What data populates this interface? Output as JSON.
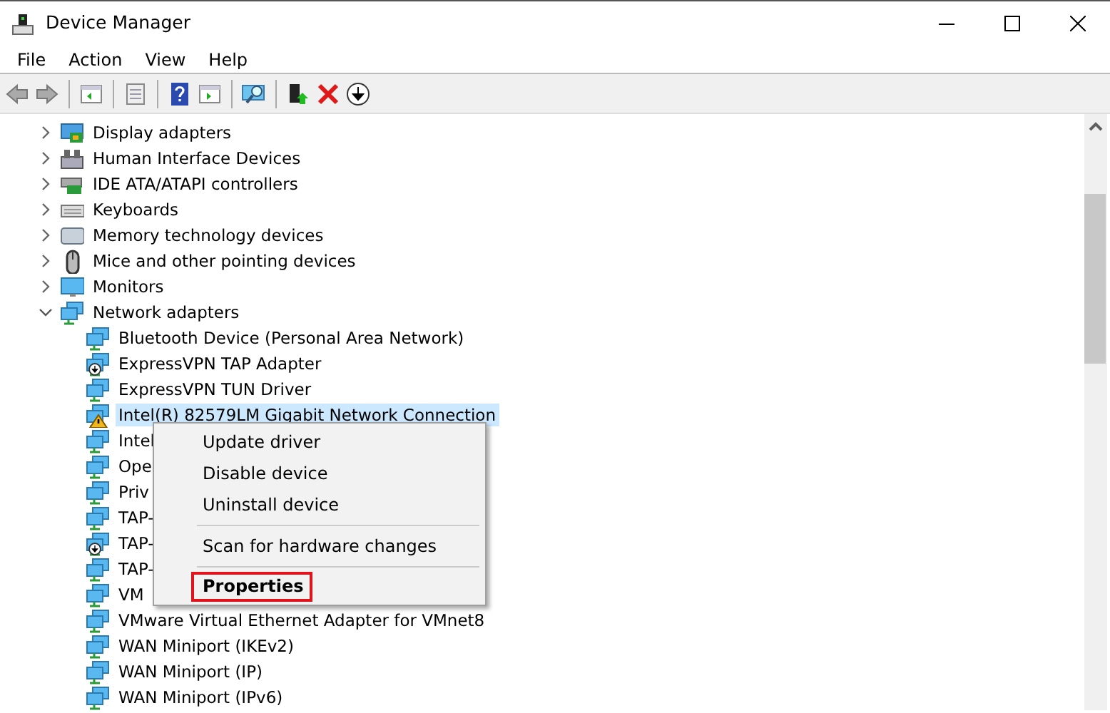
{
  "window": {
    "title": "Device Manager"
  },
  "menu": [
    "File",
    "Action",
    "View",
    "Help"
  ],
  "toolbar": [
    {
      "kind": "back"
    },
    {
      "kind": "forward"
    },
    {
      "kind": "sep"
    },
    {
      "kind": "panel"
    },
    {
      "kind": "sep"
    },
    {
      "kind": "sheet"
    },
    {
      "kind": "sep"
    },
    {
      "kind": "help"
    },
    {
      "kind": "panel2"
    },
    {
      "kind": "sep"
    },
    {
      "kind": "scan"
    },
    {
      "kind": "sep"
    },
    {
      "kind": "enable"
    },
    {
      "kind": "remove"
    },
    {
      "kind": "download"
    }
  ],
  "tree": [
    {
      "label": "Display adapters",
      "kind": "display",
      "expanded": false
    },
    {
      "label": "Human Interface Devices",
      "kind": "hid",
      "expanded": false
    },
    {
      "label": "IDE ATA/ATAPI controllers",
      "kind": "ide",
      "expanded": false
    },
    {
      "label": "Keyboards",
      "kind": "keyboard",
      "expanded": false
    },
    {
      "label": "Memory technology devices",
      "kind": "memory",
      "expanded": false
    },
    {
      "label": "Mice and other pointing devices",
      "kind": "mouse",
      "expanded": false
    },
    {
      "label": "Monitors",
      "kind": "monitor",
      "expanded": false
    },
    {
      "label": "Network adapters",
      "kind": "network",
      "expanded": true,
      "children": [
        {
          "label": "Bluetooth Device (Personal Area Network)",
          "kind": "network",
          "selected": false
        },
        {
          "label": "ExpressVPN TAP Adapter",
          "kind": "disabled",
          "selected": false
        },
        {
          "label": "ExpressVPN TUN Driver",
          "kind": "network",
          "selected": false
        },
        {
          "label": "Intel(R) 82579LM Gigabit Network Connection",
          "kind": "warning",
          "selected": true
        },
        {
          "label": "Intel",
          "kind": "network",
          "selected": false
        },
        {
          "label": "Ope",
          "kind": "network",
          "selected": false
        },
        {
          "label": "Priv",
          "kind": "network",
          "selected": false
        },
        {
          "label": "TAP-",
          "kind": "network",
          "selected": false
        },
        {
          "label": "TAP-",
          "kind": "disabled",
          "selected": false
        },
        {
          "label": "TAP-",
          "kind": "network",
          "selected": false
        },
        {
          "label": "VM",
          "kind": "network",
          "selected": false
        },
        {
          "label": "VMware Virtual Ethernet Adapter for VMnet8",
          "kind": "network",
          "selected": false
        },
        {
          "label": "WAN Miniport (IKEv2)",
          "kind": "network",
          "selected": false
        },
        {
          "label": "WAN Miniport (IP)",
          "kind": "network",
          "selected": false
        },
        {
          "label": "WAN Miniport (IPv6)",
          "kind": "network",
          "selected": false
        }
      ]
    }
  ],
  "context_menu": [
    {
      "kind": "item",
      "label": "Update driver",
      "highlighted": false
    },
    {
      "kind": "item",
      "label": "Disable device",
      "highlighted": false
    },
    {
      "kind": "item",
      "label": "Uninstall device",
      "highlighted": false
    },
    {
      "kind": "separator"
    },
    {
      "kind": "item",
      "label": "Scan for hardware changes",
      "highlighted": false
    },
    {
      "kind": "separator"
    },
    {
      "kind": "item",
      "label": "Properties",
      "highlighted": true
    }
  ]
}
